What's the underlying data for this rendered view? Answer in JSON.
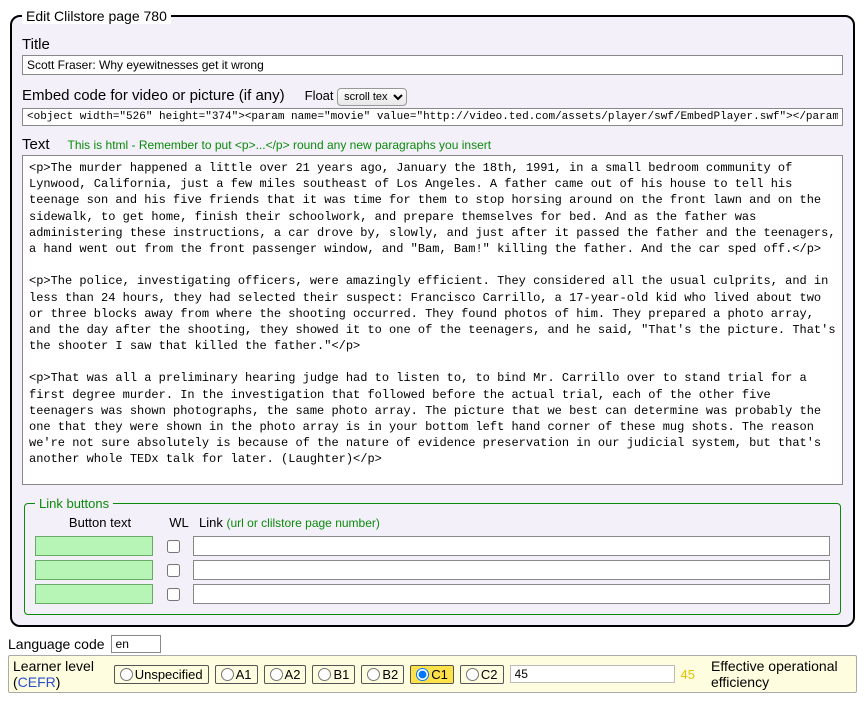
{
  "legend": "Edit Clilstore page 780",
  "title": {
    "label": "Title",
    "value": "Scott Fraser: Why eyewitnesses get it wrong"
  },
  "embed": {
    "label": "Embed code for video or picture (if any)",
    "float_label": "Float",
    "float_value": "scroll tex",
    "value": "<object width=\"526\" height=\"374\"><param name=\"movie\" value=\"http://video.ted.com/assets/player/swf/EmbedPlayer.swf\"></param><param name=\"allowFullScreen\" value=\"true\" />"
  },
  "text": {
    "label": "Text",
    "hint": "This is html - Remember to put <p>...</p> round any new paragraphs you insert",
    "body": "<p>The murder happened a little over 21 years ago, January the 18th, 1991, in a small bedroom community of Lynwood, California, just a few miles southeast of Los Angeles. A father came out of his house to tell his teenage son and his five friends that it was time for them to stop horsing around on the front lawn and on the sidewalk, to get home, finish their schoolwork, and prepare themselves for bed. And as the father was administering these instructions, a car drove by, slowly, and just after it passed the father and the teenagers, a hand went out from the front passenger window, and \"Bam, Bam!\" killing the father. And the car sped off.</p>\n\n<p>The police, investigating officers, were amazingly efficient. They considered all the usual culprits, and in less than 24 hours, they had selected their suspect: Francisco Carrillo, a 17-year-old kid who lived about two or three blocks away from where the shooting occurred. They found photos of him. They prepared a photo array, and the day after the shooting, they showed it to one of the teenagers, and he said, \"That's the picture. That's the shooter I saw that killed the father.\"</p>\n\n<p>That was all a preliminary hearing judge had to listen to, to bind Mr. Carrillo over to stand trial for a first degree murder. In the investigation that followed before the actual trial, each of the other five teenagers was shown photographs, the same photo array. The picture that we best can determine was probably the one that they were shown in the photo array is in your bottom left hand corner of these mug shots. The reason we're not sure absolutely is because of the nature of evidence preservation in our judicial system, but that's another whole TEDx talk for later. (Laughter)</p>\n\n<p>So at the actual trial, all six of the teenagers testified, and indicated the identifications they had made in the photo array. He was convicted. He was sentenced to life imprisonment, and transported to Folsom Prison.</p>\n\n<p>So what's wrong? Straightforward, fair trial, full investigation. Oh yes, no gun was ever found. No vehicle was ever identified as being the one in which the shooter had extended his arm, and no person was ever charged with being the driver of the shooter's vehicle. And Mr. Carrillo's alibi? Which of those parents here in the room might not lie concerning the whereabouts of your son or daughter in an investigation of a killing?</p>\n\n<p>Sent to prison, adamantly insisting on his innocence, which he has consistently for 21 years.</p>\n\n<p>So what's the problem? The problems actually for this kind of case come manyfold from decades of scientific research"
  },
  "linkbuttons": {
    "legend": "Link buttons",
    "headers": {
      "button": "Button text",
      "wl": "WL",
      "link": "Link",
      "note": "(url or clilstore page number)"
    },
    "rows": [
      {
        "button": "",
        "wl": false,
        "link": ""
      },
      {
        "button": "",
        "wl": false,
        "link": ""
      },
      {
        "button": "",
        "wl": false,
        "link": ""
      }
    ]
  },
  "language": {
    "label": "Language code",
    "value": "en"
  },
  "level": {
    "label": "Learner level (",
    "cefr": "CEFR",
    "label_close": ")",
    "options": [
      "Unspecified",
      "A1",
      "A2",
      "B1",
      "B2",
      "C1",
      "C2"
    ],
    "selected": "C1",
    "slider": "45",
    "mirror": "45",
    "desc": "Effective operational efficiency"
  }
}
